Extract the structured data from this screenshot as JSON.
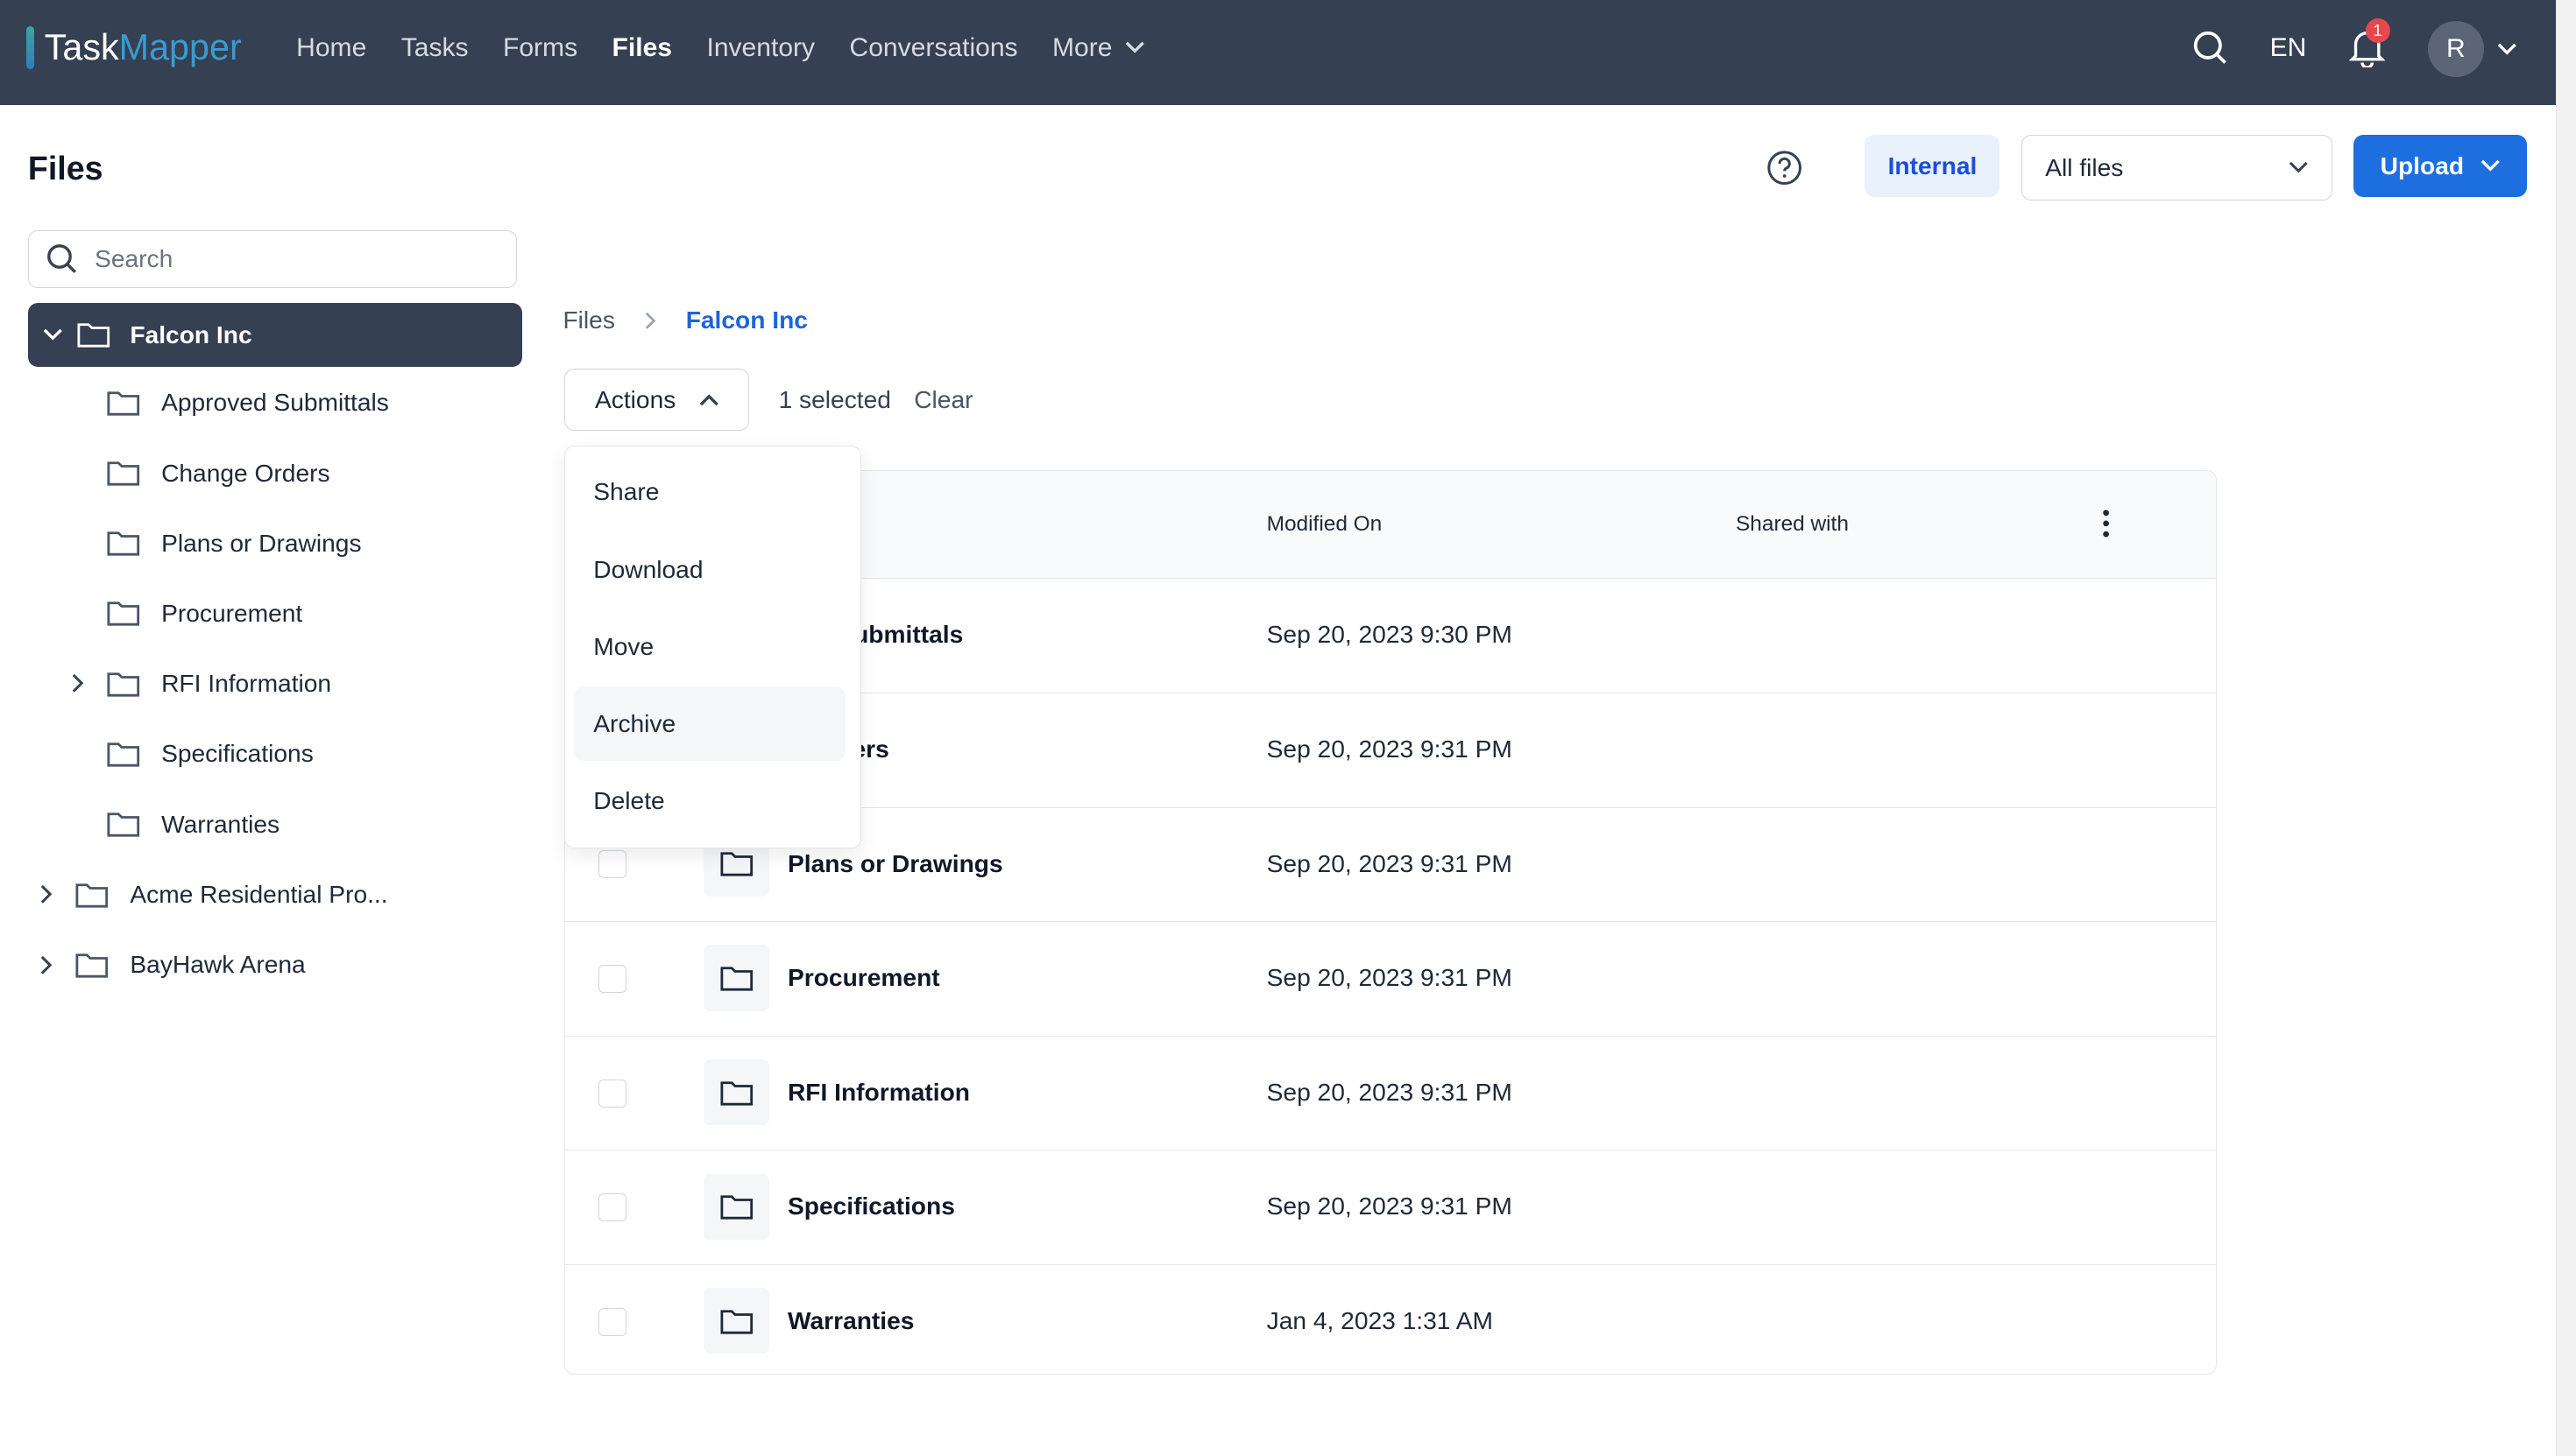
{
  "app": {
    "logo_part1": "Task",
    "logo_part2": "Mapper"
  },
  "nav": {
    "items": [
      "Home",
      "Tasks",
      "Forms",
      "Files",
      "Inventory",
      "Conversations",
      "More"
    ],
    "active": "Files"
  },
  "header": {
    "language": "EN",
    "notification_count": "1",
    "avatar_initial": "R"
  },
  "page": {
    "title": "Files",
    "internal_label": "Internal",
    "filter_value": "All files",
    "upload_label": "Upload",
    "help_icon": "question-circle-icon"
  },
  "sidebar": {
    "search_placeholder": "Search",
    "selected": "Falcon Inc",
    "children": [
      "Approved Submittals",
      "Change Orders",
      "Plans or Drawings",
      "Procurement",
      "RFI Information",
      "Specifications",
      "Warranties"
    ],
    "others": [
      "Acme Residential Pro...",
      "BayHawk Arena"
    ]
  },
  "breadcrumb": {
    "root": "Files",
    "current": "Falcon Inc"
  },
  "toolbar": {
    "actions_label": "Actions",
    "selected_text": "1 selected",
    "clear_label": "Clear"
  },
  "actions_menu": [
    "Share",
    "Download",
    "Move",
    "Archive",
    "Delete"
  ],
  "table": {
    "columns": {
      "modified": "Modified On",
      "shared": "Shared with"
    },
    "rows": [
      {
        "name": "Approved Submittals",
        "visible_name": "ved Submittals",
        "modified": "Sep 20, 2023 9:30 PM"
      },
      {
        "name": "Change Orders",
        "visible_name": "e Orders",
        "modified": "Sep 20, 2023 9:31 PM"
      },
      {
        "name": "Plans or Drawings",
        "visible_name": "Plans or Drawings",
        "modified": "Sep 20, 2023 9:31 PM"
      },
      {
        "name": "Procurement",
        "visible_name": "Procurement",
        "modified": "Sep 20, 2023 9:31 PM"
      },
      {
        "name": "RFI Information",
        "visible_name": "RFI Information",
        "modified": "Sep 20, 2023 9:31 PM"
      },
      {
        "name": "Specifications",
        "visible_name": "Specifications",
        "modified": "Sep 20, 2023 9:31 PM"
      },
      {
        "name": "Warranties",
        "visible_name": "Warranties",
        "modified": "Jan 4, 2023 1:31 AM"
      }
    ]
  },
  "colors": {
    "header_bg": "#354052",
    "accent": "#1d6fe0",
    "badge": "#e5484d"
  }
}
